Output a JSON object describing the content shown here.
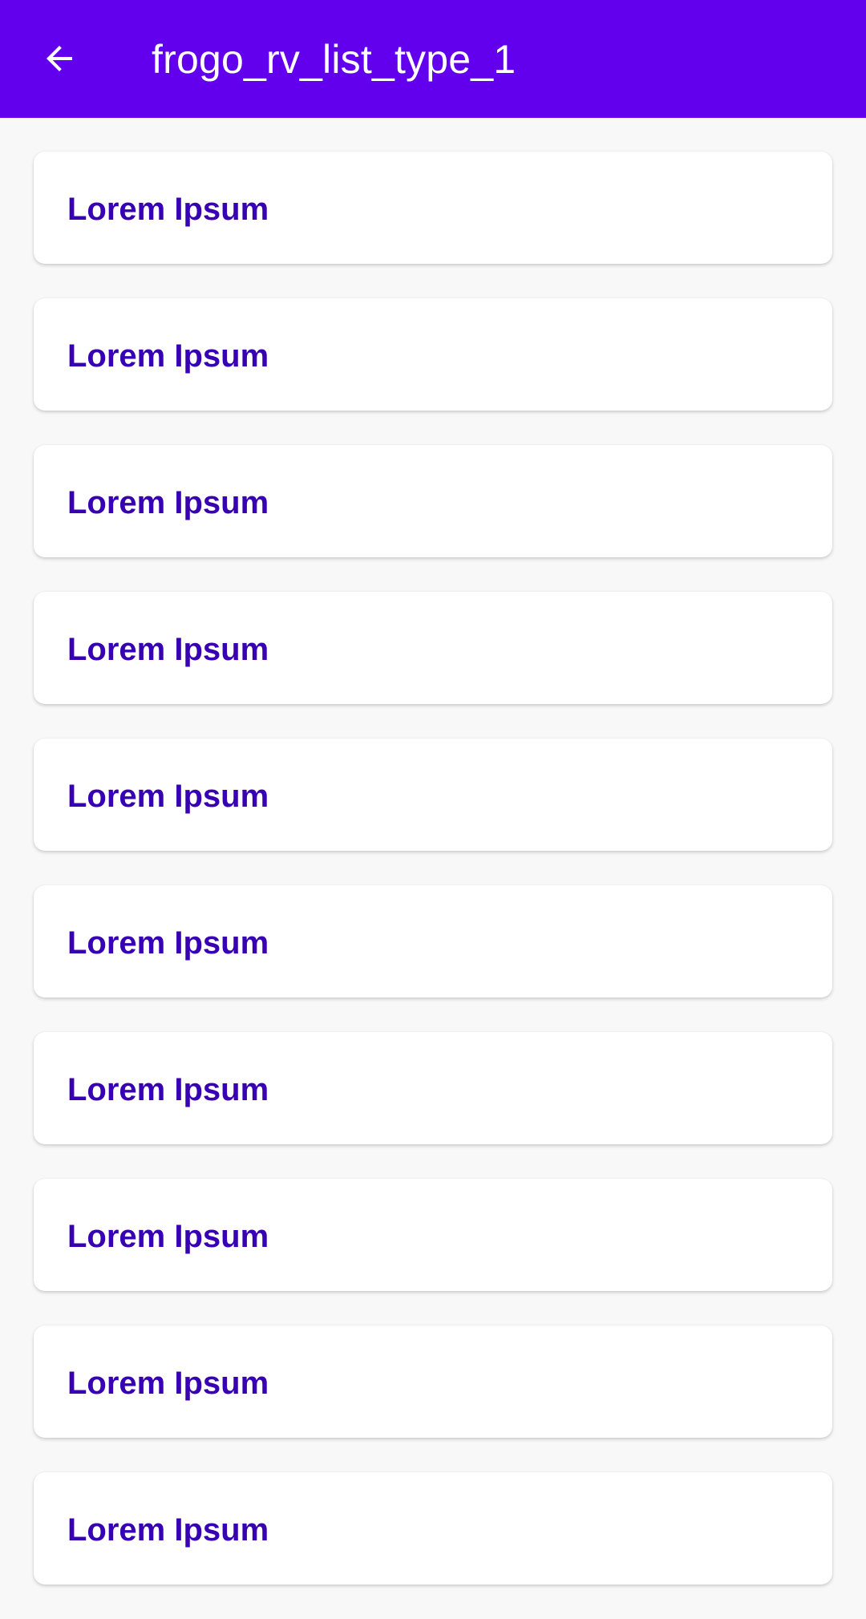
{
  "app_bar": {
    "title": "frogo_rv_list_type_1",
    "back_icon": "arrow-back-icon",
    "background": "#6200ee"
  },
  "list": {
    "items": [
      {
        "label": "Lorem Ipsum"
      },
      {
        "label": "Lorem Ipsum"
      },
      {
        "label": "Lorem Ipsum"
      },
      {
        "label": "Lorem Ipsum"
      },
      {
        "label": "Lorem Ipsum"
      },
      {
        "label": "Lorem Ipsum"
      },
      {
        "label": "Lorem Ipsum"
      },
      {
        "label": "Lorem Ipsum"
      },
      {
        "label": "Lorem Ipsum"
      },
      {
        "label": "Lorem Ipsum"
      }
    ],
    "label_color": "#3700b3"
  }
}
